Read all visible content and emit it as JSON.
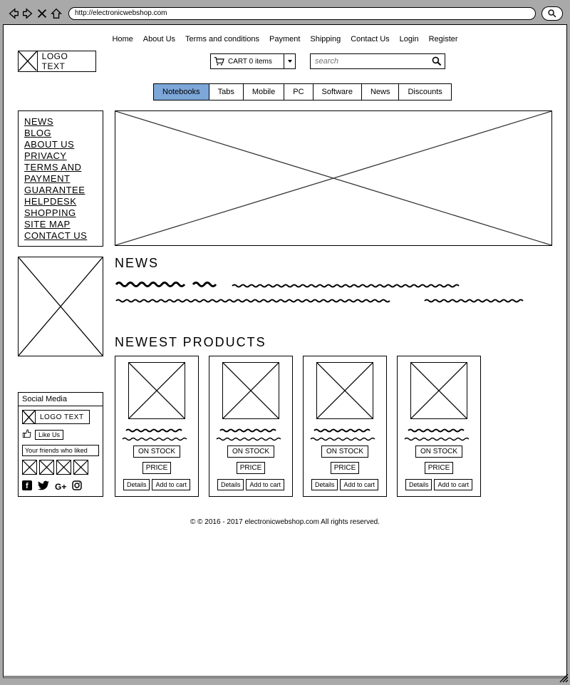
{
  "browser": {
    "url": "http://electronicwebshop.com"
  },
  "topnav": [
    "Home",
    "About Us",
    "Terms and conditions",
    "Payment",
    "Shipping",
    "Contact Us",
    "Login",
    "Register"
  ],
  "logo_text": "LOGO TEXT",
  "cart_label": "CART 0 items",
  "search_placeholder": "search",
  "tabs": [
    "Notebooks",
    "Tabs",
    "Mobile",
    "PC",
    "Software",
    "News",
    "Discounts"
  ],
  "active_tab": "Notebooks",
  "sidebar_links": [
    "NEWS",
    "BLOG",
    "ABOUT US",
    "PRIVACY",
    "TERMS AND",
    "PAYMENT",
    "GUARANTEE",
    "HELPDESK",
    "SHOPPING",
    "SITE MAP",
    "CONTACT US"
  ],
  "news_heading": "NEWS",
  "newest_heading": "NEWEST PRODUCTS",
  "social": {
    "title": "Social Media",
    "logo_text": "LOGO TEXT",
    "like_label": "Like Us",
    "friends_label": "Your friends who liked"
  },
  "product": {
    "stock_label": "ON STOCK",
    "price_label": "PRICE",
    "details_label": "Details",
    "addcart_label": "Add to cart"
  },
  "footer": "© © 2016 - 2017 electronicwebshop.com All rights reserved."
}
